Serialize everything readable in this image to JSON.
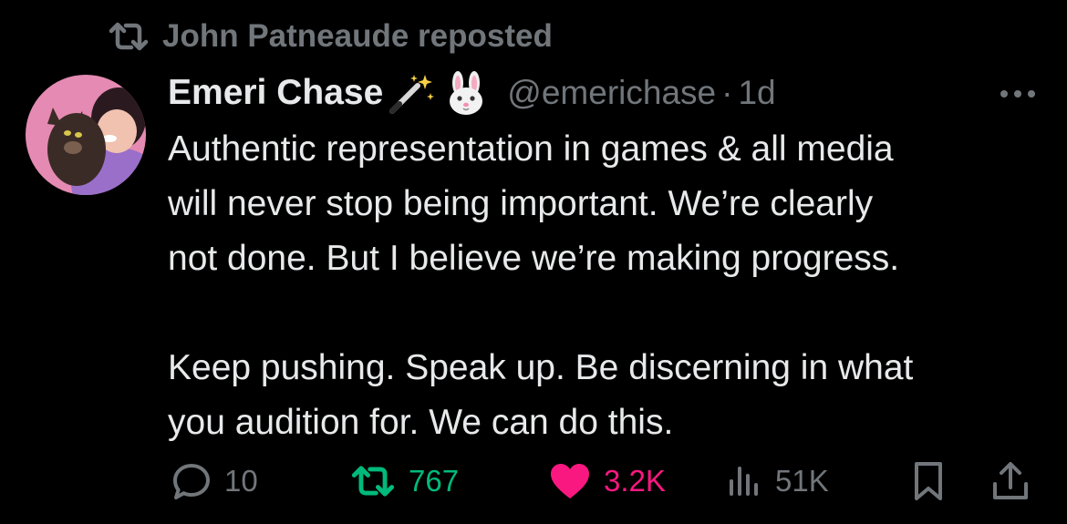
{
  "repost": {
    "icon": "repost-icon",
    "text": "John Patneaude reposted"
  },
  "author": {
    "avatar_icon": "avatar",
    "display_name": "Emeri Chase",
    "emoji_1": "magic-wand-icon",
    "emoji_2": "rabbit-face-icon",
    "handle": "@emerichase",
    "separator": "·",
    "time": "1d"
  },
  "tweet": {
    "paragraph_1": "Authentic representation in games & all media\nwill never stop being important. We’re clearly\nnot done. But I believe we’re making progress.",
    "paragraph_2": "Keep pushing. Speak up. Be discerning in what\nyou audition for. We can do this."
  },
  "actions": {
    "reply_count": "10",
    "retweet_count": "767",
    "like_count": "3.2K",
    "views_count": "51K"
  },
  "colors": {
    "background": "#000000",
    "text_primary": "#e7e9ea",
    "text_secondary": "#71767b",
    "retweet_active": "#00ba7c",
    "like_active": "#f91880"
  }
}
